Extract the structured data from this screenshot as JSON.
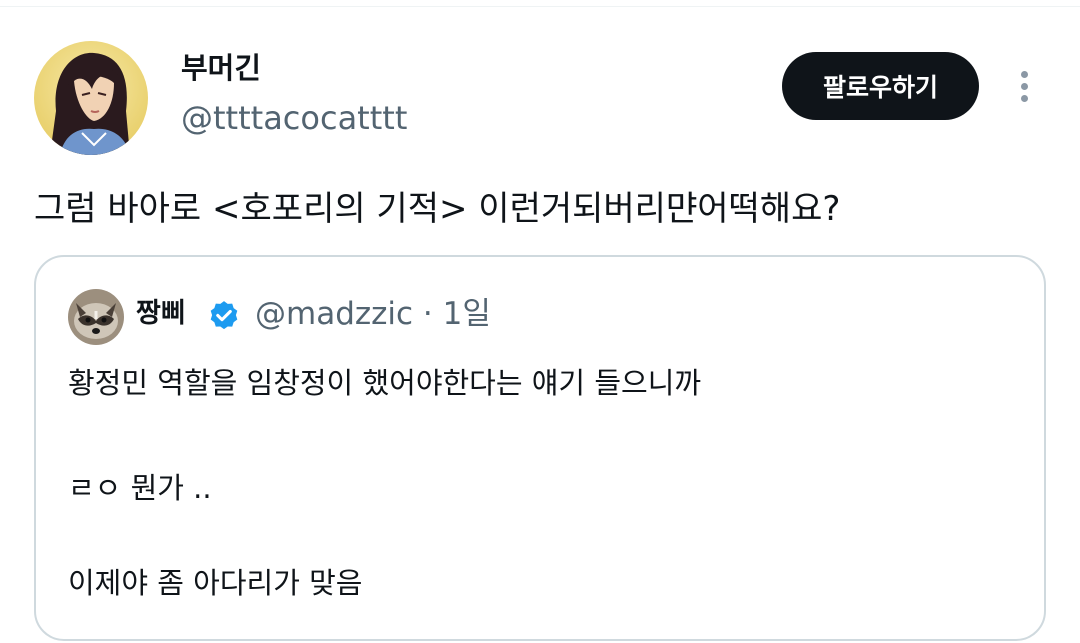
{
  "author": {
    "display_name": "부머긴",
    "handle": "@ttttacocatttt"
  },
  "follow_label": "팔로우하기",
  "tweet_text": "그럼 바아로 <호포리의 기적> 이런거되버리먄어떡해요?",
  "quote": {
    "display_name": "짱삐",
    "handle_time": "@madzzic · 1일",
    "lines": [
      "황정민 역할을 임창정이 했어야한다는 얘기 들으니까",
      "ㄹㅇ 뭔가 ..",
      "이제야 좀 아다리가 맞음"
    ]
  },
  "colors": {
    "follow_bg": "#0f1419",
    "verified": "#1d9bf0",
    "muted": "#536471",
    "border": "#cfd9de"
  }
}
